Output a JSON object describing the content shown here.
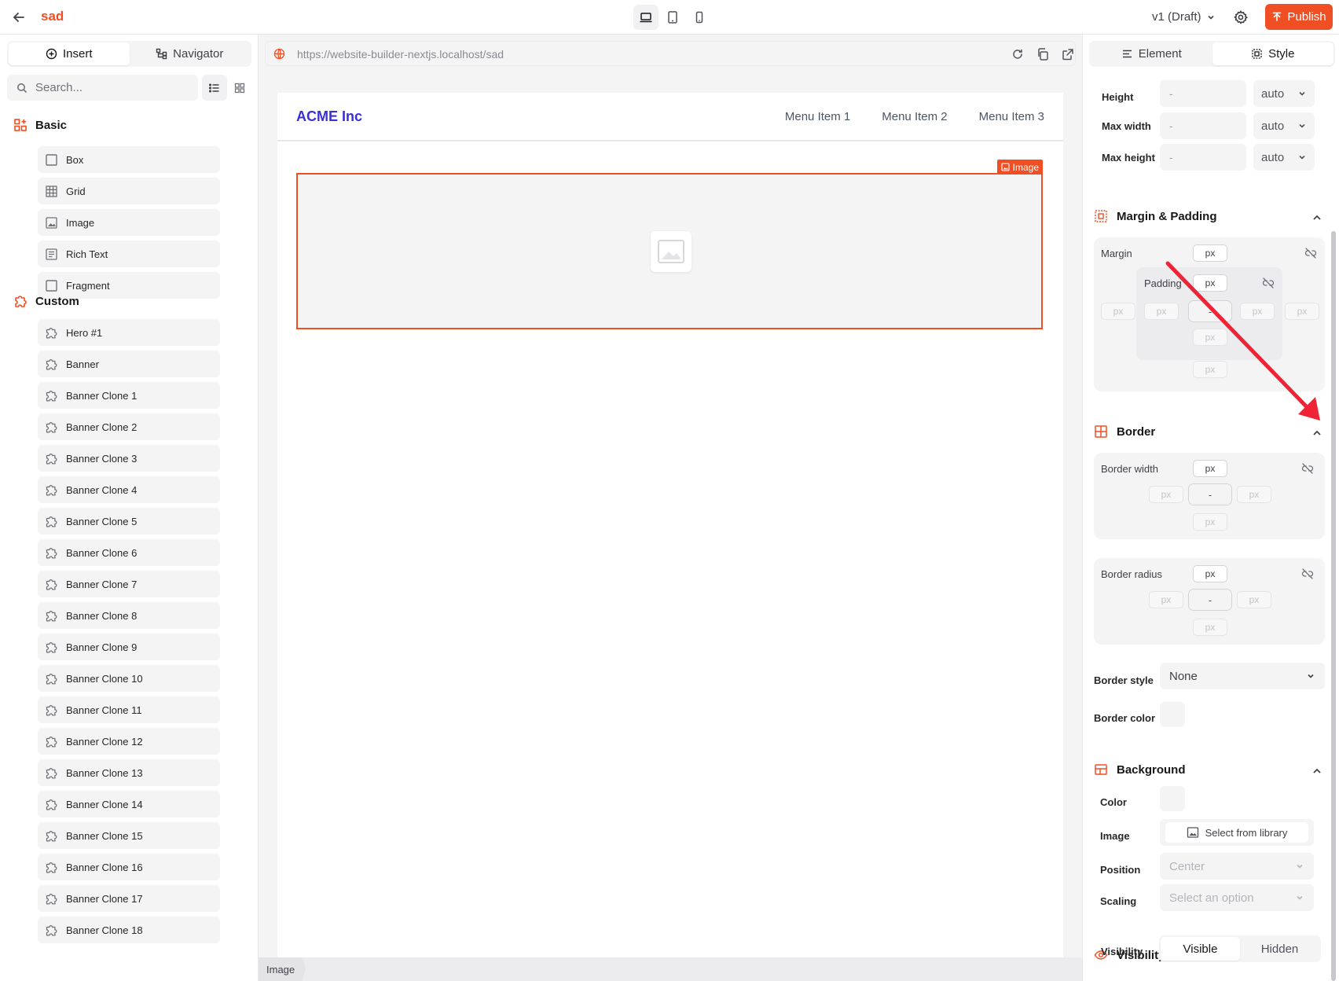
{
  "app": {
    "project_name": "sad",
    "version": "v1 (Draft)",
    "publish_label": "Publish",
    "accent": "#f04e23"
  },
  "left": {
    "tabs": [
      {
        "label": "Insert"
      },
      {
        "label": "Navigator"
      }
    ],
    "search_placeholder": "Search...",
    "basic_title": "Basic",
    "basic_items": [
      {
        "label": "Box"
      },
      {
        "label": "Grid"
      },
      {
        "label": "Image"
      },
      {
        "label": "Rich Text"
      },
      {
        "label": "Fragment"
      }
    ],
    "custom_title": "Custom",
    "custom_items": [
      {
        "label": "Hero #1"
      },
      {
        "label": "Banner"
      },
      {
        "label": "Banner Clone 1"
      },
      {
        "label": "Banner Clone 2"
      },
      {
        "label": "Banner Clone 3"
      },
      {
        "label": "Banner Clone 4"
      },
      {
        "label": "Banner Clone 5"
      },
      {
        "label": "Banner Clone 6"
      },
      {
        "label": "Banner Clone 7"
      },
      {
        "label": "Banner Clone 8"
      },
      {
        "label": "Banner Clone 9"
      },
      {
        "label": "Banner Clone 10"
      },
      {
        "label": "Banner Clone 11"
      },
      {
        "label": "Banner Clone 12"
      },
      {
        "label": "Banner Clone 13"
      },
      {
        "label": "Banner Clone 14"
      },
      {
        "label": "Banner Clone 15"
      },
      {
        "label": "Banner Clone 16"
      },
      {
        "label": "Banner Clone 17"
      },
      {
        "label": "Banner Clone 18"
      }
    ]
  },
  "canvas": {
    "url": "https://website-builder-nextjs.localhost/sad",
    "site_logo": "ACME Inc",
    "menu": [
      "Menu Item 1",
      "Menu Item 2",
      "Menu Item 3"
    ],
    "selected_badge": "Image",
    "breadcrumb": "Image"
  },
  "right": {
    "tabs": [
      {
        "label": "Element"
      },
      {
        "label": "Style"
      }
    ],
    "size": {
      "height_label": "Height",
      "max_width_label": "Max width",
      "max_height_label": "Max height",
      "placeholder": "-",
      "unit": "auto"
    },
    "margin_padding": {
      "title": "Margin & Padding",
      "margin_label": "Margin",
      "padding_label": "Padding",
      "unit": "px",
      "center": "-"
    },
    "border": {
      "title": "Border",
      "width_label": "Border width",
      "radius_label": "Border radius",
      "unit": "px",
      "center": "-",
      "style_label": "Border style",
      "style_value": "None",
      "color_label": "Border color"
    },
    "background": {
      "title": "Background",
      "color_label": "Color",
      "image_label": "Image",
      "library_btn": "Select from library",
      "position_label": "Position",
      "position_value": "Center",
      "scaling_label": "Scaling",
      "scaling_placeholder": "Select an option"
    },
    "visibility": {
      "title": "Visibility",
      "label": "Visibility",
      "options": [
        "Visible",
        "Hidden"
      ],
      "selected": "Visible"
    }
  }
}
